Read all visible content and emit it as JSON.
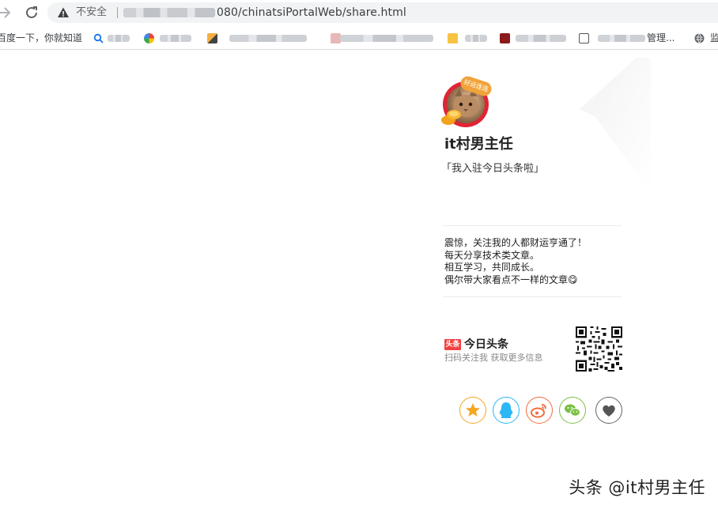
{
  "browser": {
    "security_label": "不安全",
    "url_visible": "080/chinatsiPortalWeb/share.html",
    "bookmarks": {
      "first_label": "百度一下，你就知道",
      "mgmt_label": "管理...",
      "last_label": "监"
    }
  },
  "profile": {
    "avatar_badge_text": "好运连连",
    "name": "it村男主任",
    "slogan": "「我入驻今日头条啦」"
  },
  "bio": {
    "lines": [
      "震惊，关注我的人都财运亨通了！",
      "每天分享技术类文章。",
      "相互学习，共同成长。",
      "偶尔带大家看点不一样的文章😋"
    ]
  },
  "brand": {
    "mark_text": "头条",
    "name": "今日头条",
    "subtitle": "扫码关注我 获取更多信息"
  },
  "share": {
    "icons": [
      "star-icon",
      "qq-icon",
      "weibo-icon",
      "wechat-icon",
      "heart-icon"
    ],
    "colors": {
      "favorite": "#f5a623",
      "qq": "#2db7f5",
      "weibo": "#f26d3d",
      "wechat": "#7bc144",
      "like": "#666666"
    }
  },
  "watermark": "头条 @it村男主任"
}
